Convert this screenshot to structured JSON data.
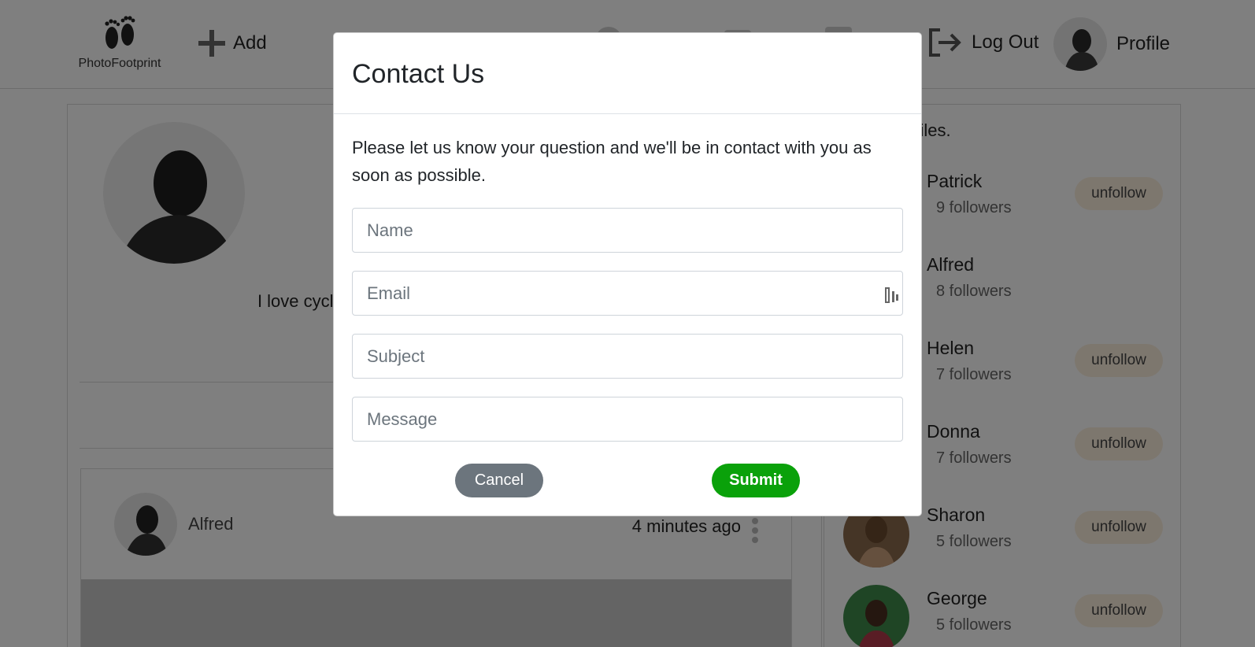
{
  "header": {
    "logo_text": "PhotoFootprint",
    "add_label": "Add",
    "logout_label": "Log Out",
    "profile_label": "Profile"
  },
  "profile": {
    "bio": "I love cycling and driving, be … smooth transition"
  },
  "post": {
    "author": "Alfred",
    "time": "4 minutes ago"
  },
  "following": {
    "title": "…ved profiles.",
    "unfollow_label": "unfollow",
    "items": [
      {
        "name": "Patrick",
        "followers": "9 followers"
      },
      {
        "name": "Alfred",
        "followers": "8 followers"
      },
      {
        "name": "Helen",
        "followers": "7 followers"
      },
      {
        "name": "Donna",
        "followers": "7 followers"
      },
      {
        "name": "Sharon",
        "followers": "5 followers"
      },
      {
        "name": "George",
        "followers": "5 followers"
      }
    ]
  },
  "modal": {
    "title": "Contact Us",
    "description": "Please let us know your question and we'll be in contact with you as soon as possible.",
    "fields": {
      "name_placeholder": "Name",
      "email_placeholder": "Email",
      "subject_placeholder": "Subject",
      "message_placeholder": "Message"
    },
    "cancel_label": "Cancel",
    "submit_label": "Submit"
  },
  "colors": {
    "submit": "#0aa10a",
    "cancel": "#6c757d",
    "unfollow": "#fbeedd"
  }
}
